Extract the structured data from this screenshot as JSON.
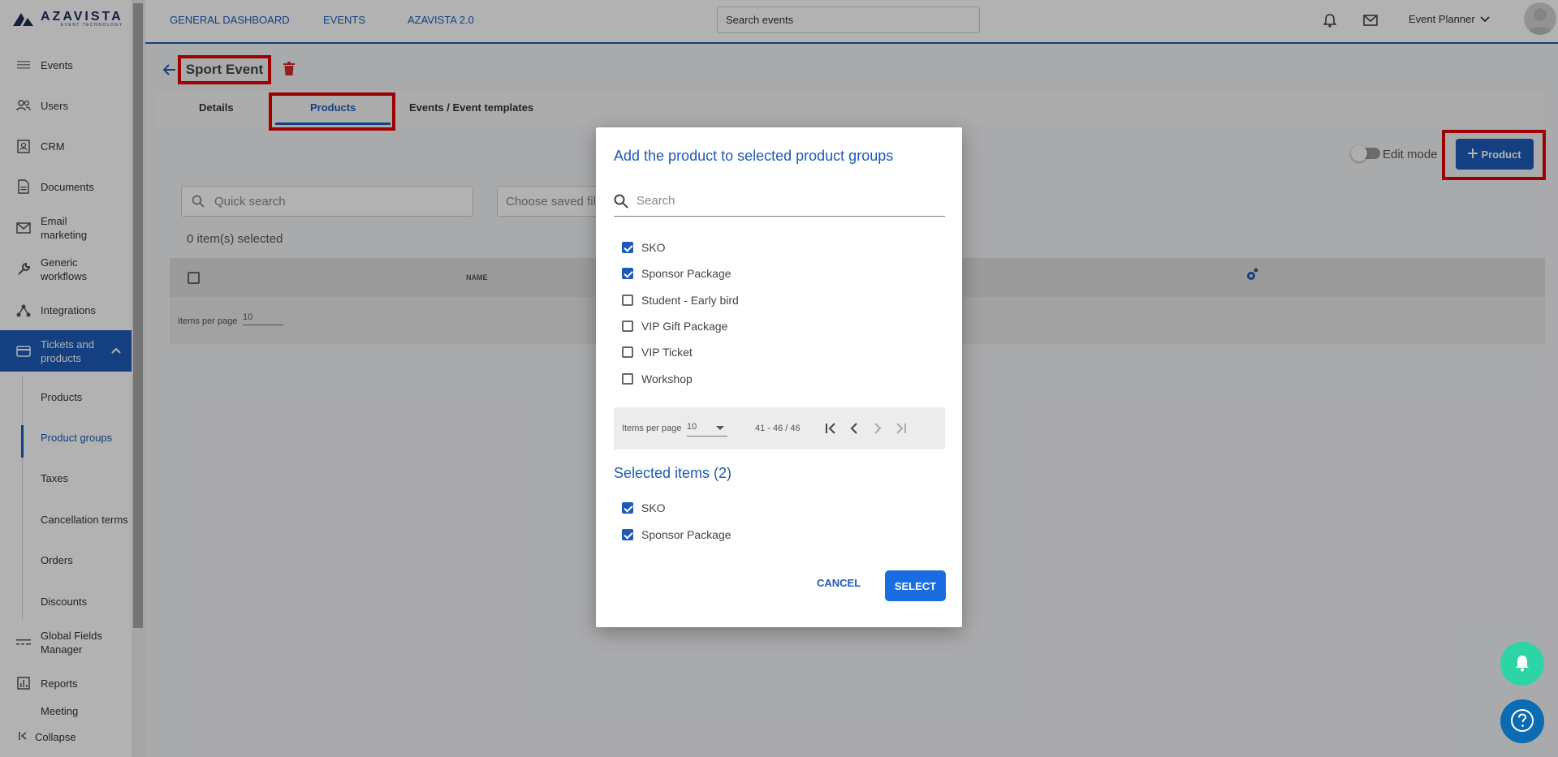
{
  "brand": {
    "name": "AZAVISTA",
    "tagline": "EVENT TECHNOLOGY"
  },
  "sidebar": {
    "items": [
      {
        "label": "Events",
        "icon": "list-icon"
      },
      {
        "label": "Users",
        "icon": "users-icon"
      },
      {
        "label": "CRM",
        "icon": "contact-card-icon"
      },
      {
        "label": "Documents",
        "icon": "document-icon"
      },
      {
        "label": "Email marketing",
        "icon": "mail-icon"
      },
      {
        "label": "Generic workflows",
        "icon": "wrench-icon"
      },
      {
        "label": "Integrations",
        "icon": "integrations-icon"
      },
      {
        "label": "Tickets and products",
        "icon": "card-icon"
      }
    ],
    "subitems": [
      {
        "label": "Products"
      },
      {
        "label": "Product groups"
      },
      {
        "label": "Taxes"
      },
      {
        "label": "Cancellation terms"
      },
      {
        "label": "Orders"
      },
      {
        "label": "Discounts"
      }
    ],
    "more": [
      {
        "label": "Global Fields Manager",
        "icon": "fields-icon"
      },
      {
        "label": "Reports",
        "icon": "reports-icon"
      },
      {
        "label": "Meeting"
      }
    ],
    "collapse_label": "Collapse"
  },
  "topbar": {
    "links": [
      "GENERAL DASHBOARD",
      "EVENTS",
      "AZAVISTA 2.0"
    ],
    "search_placeholder": "Search events",
    "user_label": "Event Planner"
  },
  "page": {
    "title": "Sport Event",
    "tabs": [
      "Details",
      "Products",
      "Events / Event templates"
    ],
    "edit_mode_label": "Edit mode",
    "add_product_label": "Product",
    "quick_search_placeholder": "Quick search",
    "saved_filter_placeholder": "Choose saved filt",
    "selected_count": "0 item(s) selected",
    "table": {
      "name_header": "NAME",
      "items_per_page_label": "Items per page",
      "items_per_page_value": "10"
    }
  },
  "modal": {
    "title": "Add the product to selected product groups",
    "search_placeholder": "Search",
    "options": [
      {
        "label": "SKO",
        "checked": true
      },
      {
        "label": "Sponsor Package",
        "checked": true
      },
      {
        "label": "Student - Early bird",
        "checked": false
      },
      {
        "label": "VIP Gift Package",
        "checked": false
      },
      {
        "label": "VIP Ticket",
        "checked": false
      },
      {
        "label": "Workshop",
        "checked": false
      }
    ],
    "pager": {
      "items_per_page_label": "Items per page",
      "items_per_page_value": "10",
      "range": "41 - 46 / 46"
    },
    "selected_title": "Selected items (2)",
    "selected_items": [
      {
        "label": "SKO",
        "checked": true
      },
      {
        "label": "Sponsor Package",
        "checked": true
      }
    ],
    "cancel_label": "CANCEL",
    "select_label": "SELECT"
  },
  "colors": {
    "accent": "#1e5bb8",
    "highlight_box": "#e00000",
    "fab_bell": "#2dd4a6",
    "fab_help": "#0b6bb3"
  }
}
